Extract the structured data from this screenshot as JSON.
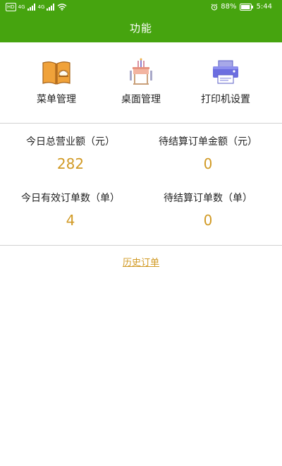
{
  "status_bar": {
    "left_labels": [
      "HD",
      "4G",
      "4G"
    ],
    "battery": "88%",
    "time": "5:44"
  },
  "header": {
    "title": "功能"
  },
  "functions": [
    {
      "label": "菜单管理",
      "icon": "menu-book-icon"
    },
    {
      "label": "桌面管理",
      "icon": "dining-table-icon"
    },
    {
      "label": "打印机设置",
      "icon": "printer-icon"
    }
  ],
  "stats": {
    "today_revenue_label": "今日总营业额（元）",
    "today_revenue_value": "282",
    "pending_amount_label": "待结算订单金额（元）",
    "pending_amount_value": "0",
    "today_orders_label": "今日有效订单数（单）",
    "today_orders_value": "4",
    "pending_orders_label": "待结算订单数（单）",
    "pending_orders_value": "0"
  },
  "history_link": "历史订单",
  "colors": {
    "header_bg": "#46a40f",
    "value_color": "#d19a25"
  }
}
